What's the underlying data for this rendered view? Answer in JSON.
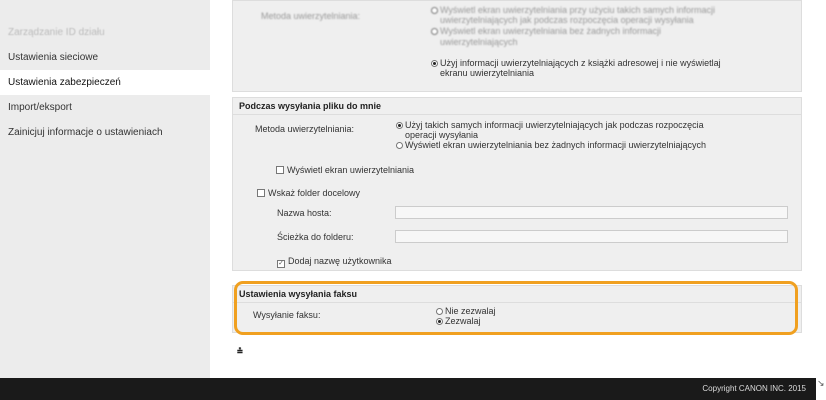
{
  "sidebar": {
    "items": [
      {
        "label": "Zarządzanie ID działu"
      },
      {
        "label": "Ustawienia sieciowe"
      },
      {
        "label": "Ustawienia zabezpieczeń"
      },
      {
        "label": "Import/eksport"
      },
      {
        "label": "Zainicjuj informacje o ustawieniach"
      }
    ]
  },
  "top": {
    "label": "Metoda uwierzytelniania:",
    "opt1": "Wyświetl ekran uwierzytelniania przy użyciu takich samych informacji",
    "opt1b": "uwierzytelniających jak podczas rozpoczęcia operacji wysyłania",
    "opt2": "Wyświetl ekran uwierzytelniania bez żadnych informacji",
    "opt2b": "uwierzytelniających",
    "opt3": "Użyj informacji uwierzytelniających z książki adresowej i nie wyświetlaj",
    "opt3b": "ekranu uwierzytelniania"
  },
  "file": {
    "title": "Podczas wysyłania pliku do mnie",
    "auth_label": "Metoda uwierzytelniania:",
    "opt1": "Użyj takich samych informacji uwierzytelniających jak podczas rozpoczęcia",
    "opt1b": "operacji wysyłania",
    "opt2": "Wyświetl ekran uwierzytelniania bez żadnych informacji uwierzytelniających",
    "show_auth": "Wyświetl ekran uwierzytelniania",
    "dest_folder": "Wskaż folder docelowy",
    "host_label": "Nazwa hosta:",
    "path_label": "Ścieżka do folderu:",
    "add_user": "Dodaj nazwę użytkownika"
  },
  "fax": {
    "title": "Ustawienia wysyłania faksu",
    "label": "Wysyłanie faksu:",
    "opt_deny": "Nie zezwalaj",
    "opt_allow": "Zezwalaj"
  },
  "footer": {
    "copyright": "Copyright CANON INC. 2015"
  },
  "top_icon": "page-top-icon"
}
